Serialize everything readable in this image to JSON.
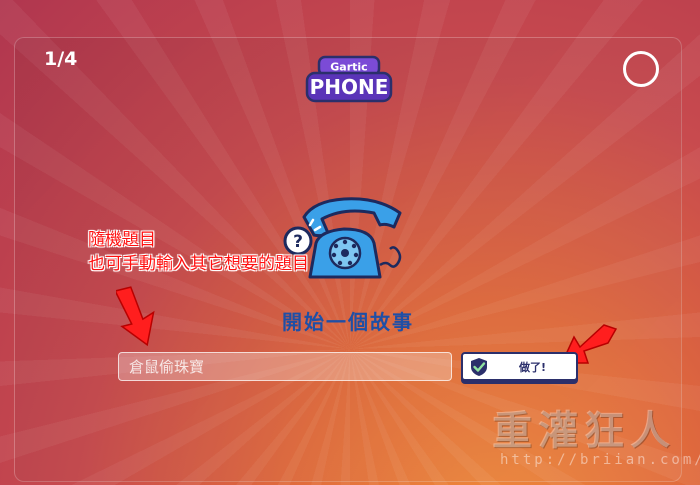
{
  "header": {
    "round_counter": "1/4",
    "logo_text_top": "Gartic",
    "logo_text_bottom": "PHONE"
  },
  "main": {
    "heading": "開始一個故事",
    "prompt_input": {
      "value": "",
      "placeholder": "倉鼠偷珠寶"
    },
    "done_button": {
      "label": "做了!"
    },
    "illustration": "question-telephone-icon"
  },
  "annotation": {
    "line1": "隨機題目",
    "line2": "也可手動輸入其它想要的題目",
    "color": "#ff1010"
  },
  "watermark": {
    "text": "重灌狂人",
    "url": "http://briian.com/"
  },
  "colors": {
    "accent": "#2b2f6b",
    "heading": "#1f4fa6",
    "phone": "#3aa0e8"
  }
}
